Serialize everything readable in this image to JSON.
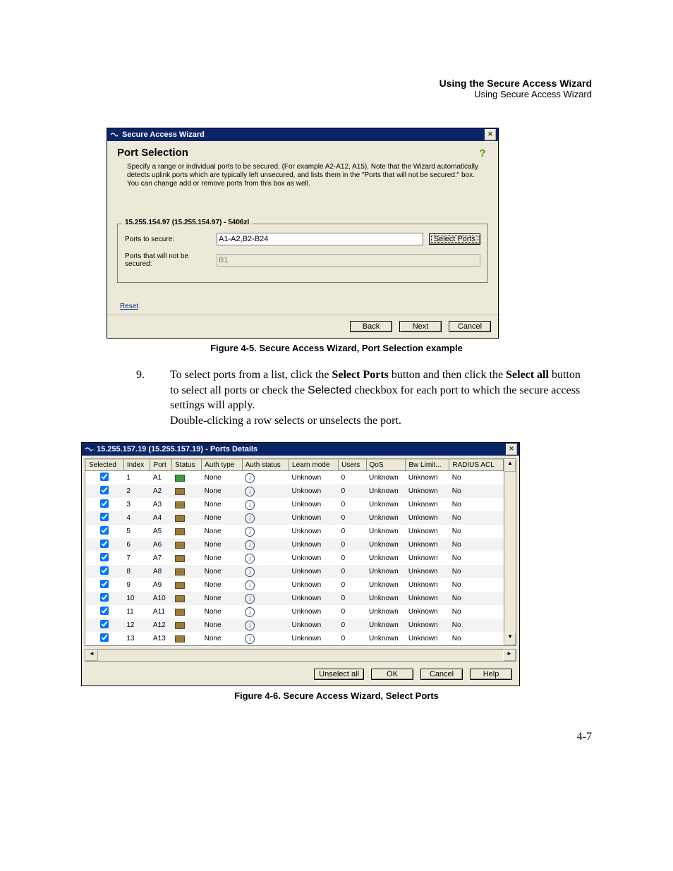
{
  "header": {
    "title": "Using the Secure Access Wizard",
    "subtitle": "Using Secure Access Wizard"
  },
  "dialog1": {
    "title": "Secure Access Wizard",
    "sectionHeading": "Port Selection",
    "description": "Specify a range or individual ports to be secured. (For example A2-A12, A15). Note that the Wizard automatically detects uplink ports which are typically left unsecured, and lists them in the \"Ports that will not be secured:\" box. You can change add or remove ports from this box as well.",
    "legend": "15.255.154.97 (15.255.154.97) - 5406zl",
    "portsToSecureLabel": "Ports to secure:",
    "portsToSecureValue": "A1-A2,B2-B24",
    "portsNotSecuredLabel": "Ports that will not be secured:",
    "portsNotSecuredValue": "B1",
    "selectPortsBtn": "Select Ports",
    "resetLink": "Reset",
    "backBtn": "Back",
    "nextBtn": "Next",
    "cancelBtn": "Cancel"
  },
  "caption1": "Figure 4-5. Secure Access Wizard, Port Selection example",
  "step": {
    "number": "9.",
    "textA": "To select ports from a list, click the ",
    "textB": " button and then click the ",
    "textC": " button to select all ports or check the ",
    "textD": " checkbox for each port to which the secure access settings will apply.",
    "bold1": "Select Ports",
    "bold2": "Select all",
    "sans1": "Selected",
    "line2": "Double-clicking a row selects or unselects the port."
  },
  "dialog2": {
    "title": "15.255.157.19 (15.255.157.19) - Ports Details",
    "columns": {
      "selected": "Selected",
      "index": "Index",
      "port": "Port",
      "status": "Status",
      "authType": "Auth type",
      "authStatus": "Auth status",
      "learnMode": "Learn mode",
      "users": "Users",
      "qos": "QoS",
      "bwLimit": "Bw Limit...",
      "radiusAcl": "RADIUS ACL"
    },
    "rows": [
      {
        "sel": true,
        "idx": "1",
        "port": "A1",
        "green": true,
        "auth": "None",
        "learn": "Unknown",
        "users": "0",
        "qos": "Unknown",
        "bw": "Unknown",
        "acl": "No"
      },
      {
        "sel": true,
        "idx": "2",
        "port": "A2",
        "green": false,
        "auth": "None",
        "learn": "Unknown",
        "users": "0",
        "qos": "Unknown",
        "bw": "Unknown",
        "acl": "No"
      },
      {
        "sel": true,
        "idx": "3",
        "port": "A3",
        "green": false,
        "auth": "None",
        "learn": "Unknown",
        "users": "0",
        "qos": "Unknown",
        "bw": "Unknown",
        "acl": "No"
      },
      {
        "sel": true,
        "idx": "4",
        "port": "A4",
        "green": false,
        "auth": "None",
        "learn": "Unknown",
        "users": "0",
        "qos": "Unknown",
        "bw": "Unknown",
        "acl": "No"
      },
      {
        "sel": true,
        "idx": "5",
        "port": "A5",
        "green": false,
        "auth": "None",
        "learn": "Unknown",
        "users": "0",
        "qos": "Unknown",
        "bw": "Unknown",
        "acl": "No"
      },
      {
        "sel": true,
        "idx": "6",
        "port": "A6",
        "green": false,
        "auth": "None",
        "learn": "Unknown",
        "users": "0",
        "qos": "Unknown",
        "bw": "Unknown",
        "acl": "No"
      },
      {
        "sel": true,
        "idx": "7",
        "port": "A7",
        "green": false,
        "auth": "None",
        "learn": "Unknown",
        "users": "0",
        "qos": "Unknown",
        "bw": "Unknown",
        "acl": "No"
      },
      {
        "sel": true,
        "idx": "8",
        "port": "A8",
        "green": false,
        "auth": "None",
        "learn": "Unknown",
        "users": "0",
        "qos": "Unknown",
        "bw": "Unknown",
        "acl": "No"
      },
      {
        "sel": true,
        "idx": "9",
        "port": "A9",
        "green": false,
        "auth": "None",
        "learn": "Unknown",
        "users": "0",
        "qos": "Unknown",
        "bw": "Unknown",
        "acl": "No"
      },
      {
        "sel": true,
        "idx": "10",
        "port": "A10",
        "green": false,
        "auth": "None",
        "learn": "Unknown",
        "users": "0",
        "qos": "Unknown",
        "bw": "Unknown",
        "acl": "No"
      },
      {
        "sel": true,
        "idx": "11",
        "port": "A11",
        "green": false,
        "auth": "None",
        "learn": "Unknown",
        "users": "0",
        "qos": "Unknown",
        "bw": "Unknown",
        "acl": "No"
      },
      {
        "sel": true,
        "idx": "12",
        "port": "A12",
        "green": false,
        "auth": "None",
        "learn": "Unknown",
        "users": "0",
        "qos": "Unknown",
        "bw": "Unknown",
        "acl": "No"
      },
      {
        "sel": true,
        "idx": "13",
        "port": "A13",
        "green": false,
        "auth": "None",
        "learn": "Unknown",
        "users": "0",
        "qos": "Unknown",
        "bw": "Unknown",
        "acl": "No"
      }
    ],
    "unselectAllBtn": "Unselect all",
    "okBtn": "OK",
    "cancelBtn": "Cancel",
    "helpBtn": "Help"
  },
  "caption2": "Figure 4-6. Secure Access Wizard, Select Ports",
  "pageNum": "4-7"
}
